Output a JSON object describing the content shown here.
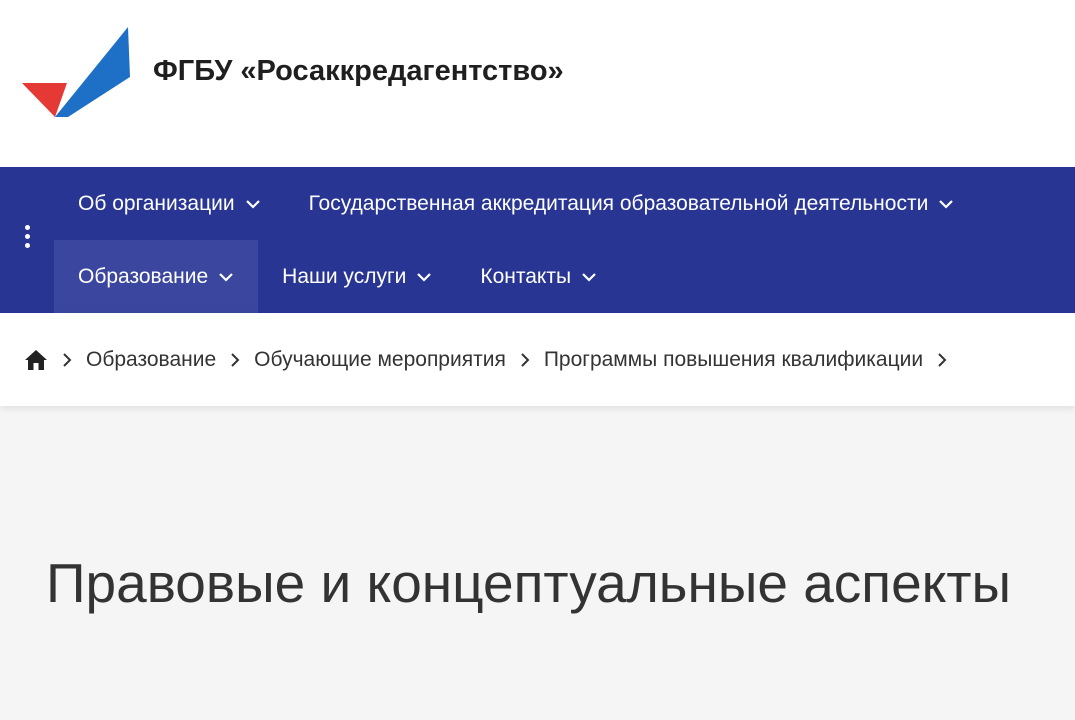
{
  "header": {
    "org_title": "ФГБУ «Росаккредагентство»",
    "colors": {
      "logo_red": "#e53935",
      "logo_blue": "#1e6fc6"
    }
  },
  "nav": {
    "background": "#283593",
    "row1": [
      {
        "label": "Об организации"
      },
      {
        "label": "Государственная аккредитация образовательной деятельности"
      }
    ],
    "row2": [
      {
        "label": "Образование",
        "active": true
      },
      {
        "label": "Наши услуги"
      },
      {
        "label": "Контакты"
      }
    ]
  },
  "breadcrumb": {
    "items": [
      "Образование",
      "Обучающие мероприятия",
      "Программы повышения квалификации"
    ]
  },
  "page": {
    "title": "Правовые и концептуальные аспекты"
  }
}
